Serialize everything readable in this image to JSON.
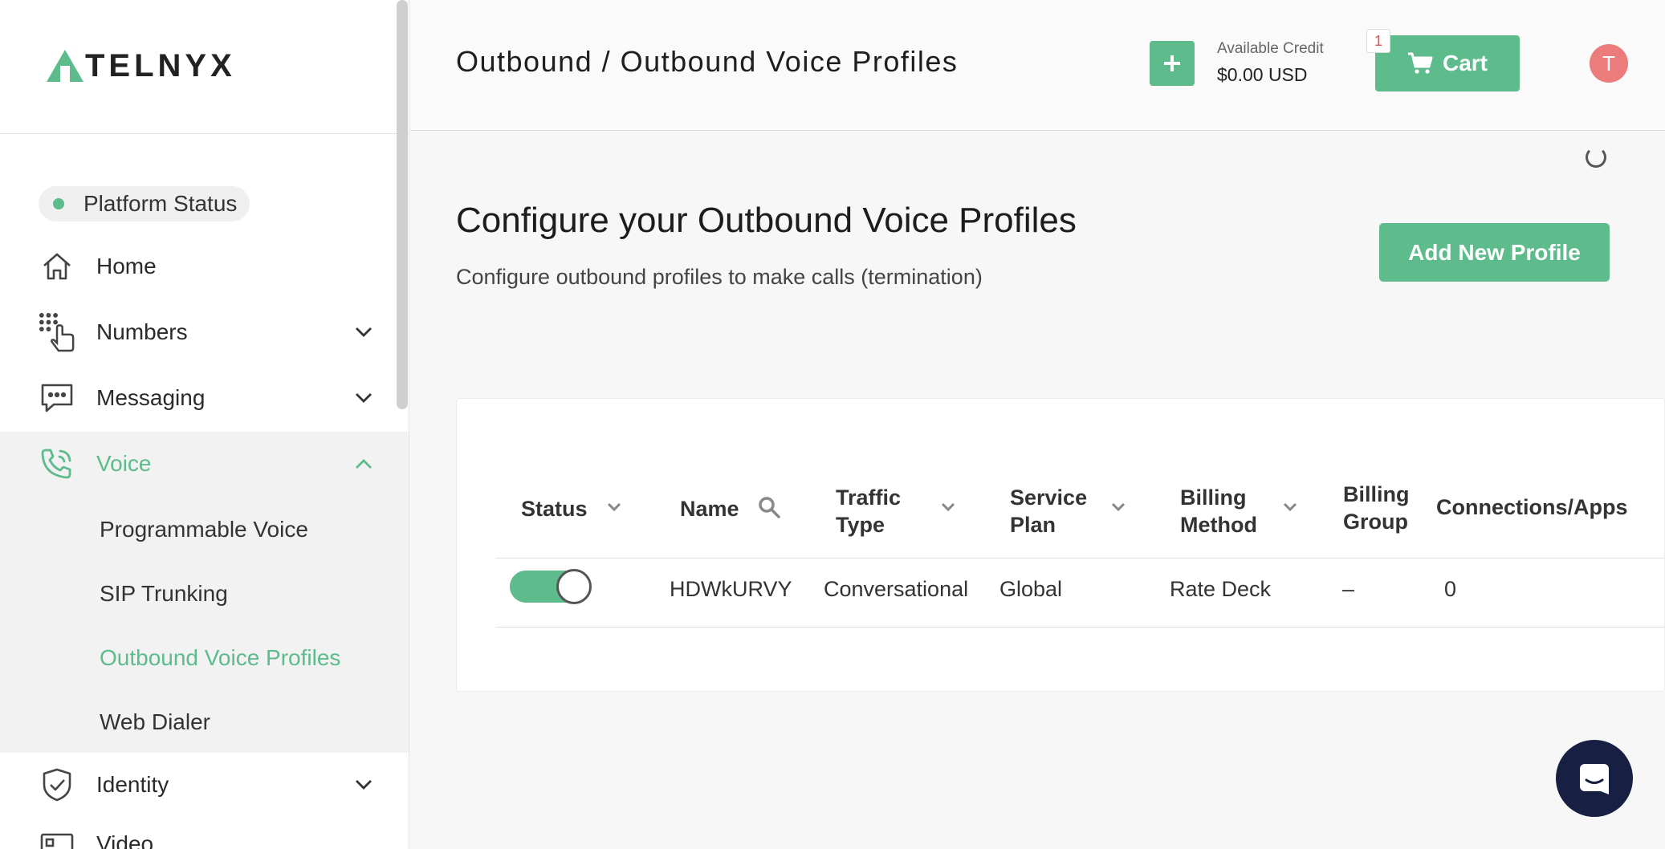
{
  "brand": {
    "name": "TELNYX",
    "accent": "#5dbb8c"
  },
  "sidebar": {
    "platform_status": "Platform Status",
    "items": [
      {
        "label": "Home",
        "icon": "home-icon"
      },
      {
        "label": "Numbers",
        "icon": "numbers-icon"
      },
      {
        "label": "Messaging",
        "icon": "messaging-icon"
      },
      {
        "label": "Voice",
        "icon": "voice-icon",
        "expanded": true
      },
      {
        "label": "Identity",
        "icon": "identity-icon"
      },
      {
        "label": "Video",
        "icon": "video-icon"
      }
    ],
    "voice_sub": [
      {
        "label": "Programmable Voice"
      },
      {
        "label": "SIP Trunking"
      },
      {
        "label": "Outbound Voice Profiles",
        "active": true
      },
      {
        "label": "Web Dialer"
      }
    ]
  },
  "header": {
    "breadcrumb": "Outbound / Outbound Voice Profiles",
    "credit_label": "Available Credit",
    "credit_value": "$0.00 USD",
    "cart_label": "Cart",
    "cart_count": "1",
    "avatar_initial": "T"
  },
  "main": {
    "title": "Configure your Outbound Voice Profiles",
    "subtitle": "Configure outbound profiles to make calls (termination)",
    "add_button": "Add New Profile"
  },
  "table": {
    "columns": [
      {
        "label": "Status"
      },
      {
        "label": "Name"
      },
      {
        "label": "Traffic Type"
      },
      {
        "label": "Service Plan"
      },
      {
        "label": "Billing Method"
      },
      {
        "label": "Billing Group"
      },
      {
        "label": "Connections/Apps"
      }
    ],
    "rows": [
      {
        "status": "enabled",
        "name": "HDWkURVY",
        "traffic_type": "Conversational",
        "service_plan": "Global",
        "billing_method": "Rate Deck",
        "billing_group": "–",
        "connections": "0"
      }
    ]
  }
}
